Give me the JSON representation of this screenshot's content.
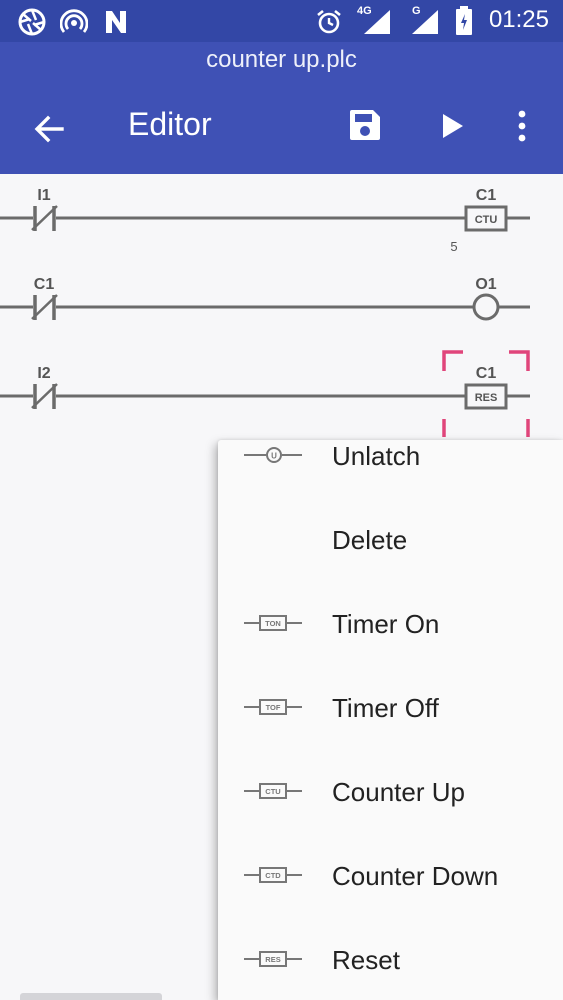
{
  "status_bar": {
    "time": "01:25",
    "network_4g": "4G",
    "network_g": "G",
    "icons": [
      "aperture-icon",
      "hotspot-icon",
      "n-logo-icon",
      "alarm-icon",
      "signal-4g-icon",
      "signal-g-icon",
      "battery-icon"
    ]
  },
  "app_bar": {
    "file_name": "counter up.plc",
    "title": "Editor",
    "icons": [
      "back-arrow-icon",
      "save-icon",
      "play-icon",
      "overflow-menu-icon"
    ]
  },
  "ladder": {
    "rungs": [
      {
        "input_label": "I1",
        "input_type": "normally-closed-contact",
        "output_label": "C1",
        "output_type": "CTU",
        "output_value": "5"
      },
      {
        "input_label": "C1",
        "input_type": "normally-closed-contact",
        "output_label": "O1",
        "output_type": "coil"
      },
      {
        "input_label": "I2",
        "input_type": "normally-closed-contact",
        "output_label": "C1",
        "output_type": "RES",
        "selected": true
      }
    ],
    "selection_color": "#e0457b"
  },
  "context_menu": {
    "items": [
      {
        "label": "Unlatch",
        "icon_text": "U",
        "icon": "unlatch-coil-icon"
      },
      {
        "label": "Delete",
        "icon_text": "",
        "icon": ""
      },
      {
        "label": "Timer On",
        "icon_text": "TON",
        "icon": "timer-on-icon"
      },
      {
        "label": "Timer Off",
        "icon_text": "TOF",
        "icon": "timer-off-icon"
      },
      {
        "label": "Counter Up",
        "icon_text": "CTU",
        "icon": "counter-up-icon"
      },
      {
        "label": "Counter Down",
        "icon_text": "CTD",
        "icon": "counter-down-icon"
      },
      {
        "label": "Reset",
        "icon_text": "RES",
        "icon": "reset-icon"
      }
    ]
  },
  "colors": {
    "status_bar": "#3347a6",
    "app_bar": "#3f51b5",
    "ladder_line": "#6b6b6b",
    "background": "#f7f7f9"
  }
}
